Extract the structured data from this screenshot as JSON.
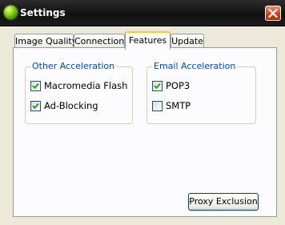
{
  "window": {
    "title": "Settings"
  },
  "tabs": [
    {
      "label": "Image Quality",
      "active": false
    },
    {
      "label": "Connection",
      "active": false
    },
    {
      "label": "Features",
      "active": true
    },
    {
      "label": "Update",
      "active": false
    }
  ],
  "groups": {
    "other": {
      "legend": "Other Acceleration",
      "items": [
        {
          "label": "Macromedia Flash",
          "checked": true
        },
        {
          "label": "Ad-Blocking",
          "checked": true
        }
      ]
    },
    "email": {
      "legend": "Email Acceleration",
      "items": [
        {
          "label": "POP3",
          "checked": true
        },
        {
          "label": "SMTP",
          "checked": false
        }
      ]
    }
  },
  "buttons": {
    "proxy_exclusion": "Proxy Exclusion"
  },
  "icons": {
    "app": "green-orb-icon",
    "close": "close-icon",
    "check": "checkmark-icon"
  },
  "colors": {
    "legend": "#0046d5",
    "tab_active_accent": "#ffc83c",
    "titlebar": "#1a1a1a",
    "close": "#cf3b17"
  }
}
